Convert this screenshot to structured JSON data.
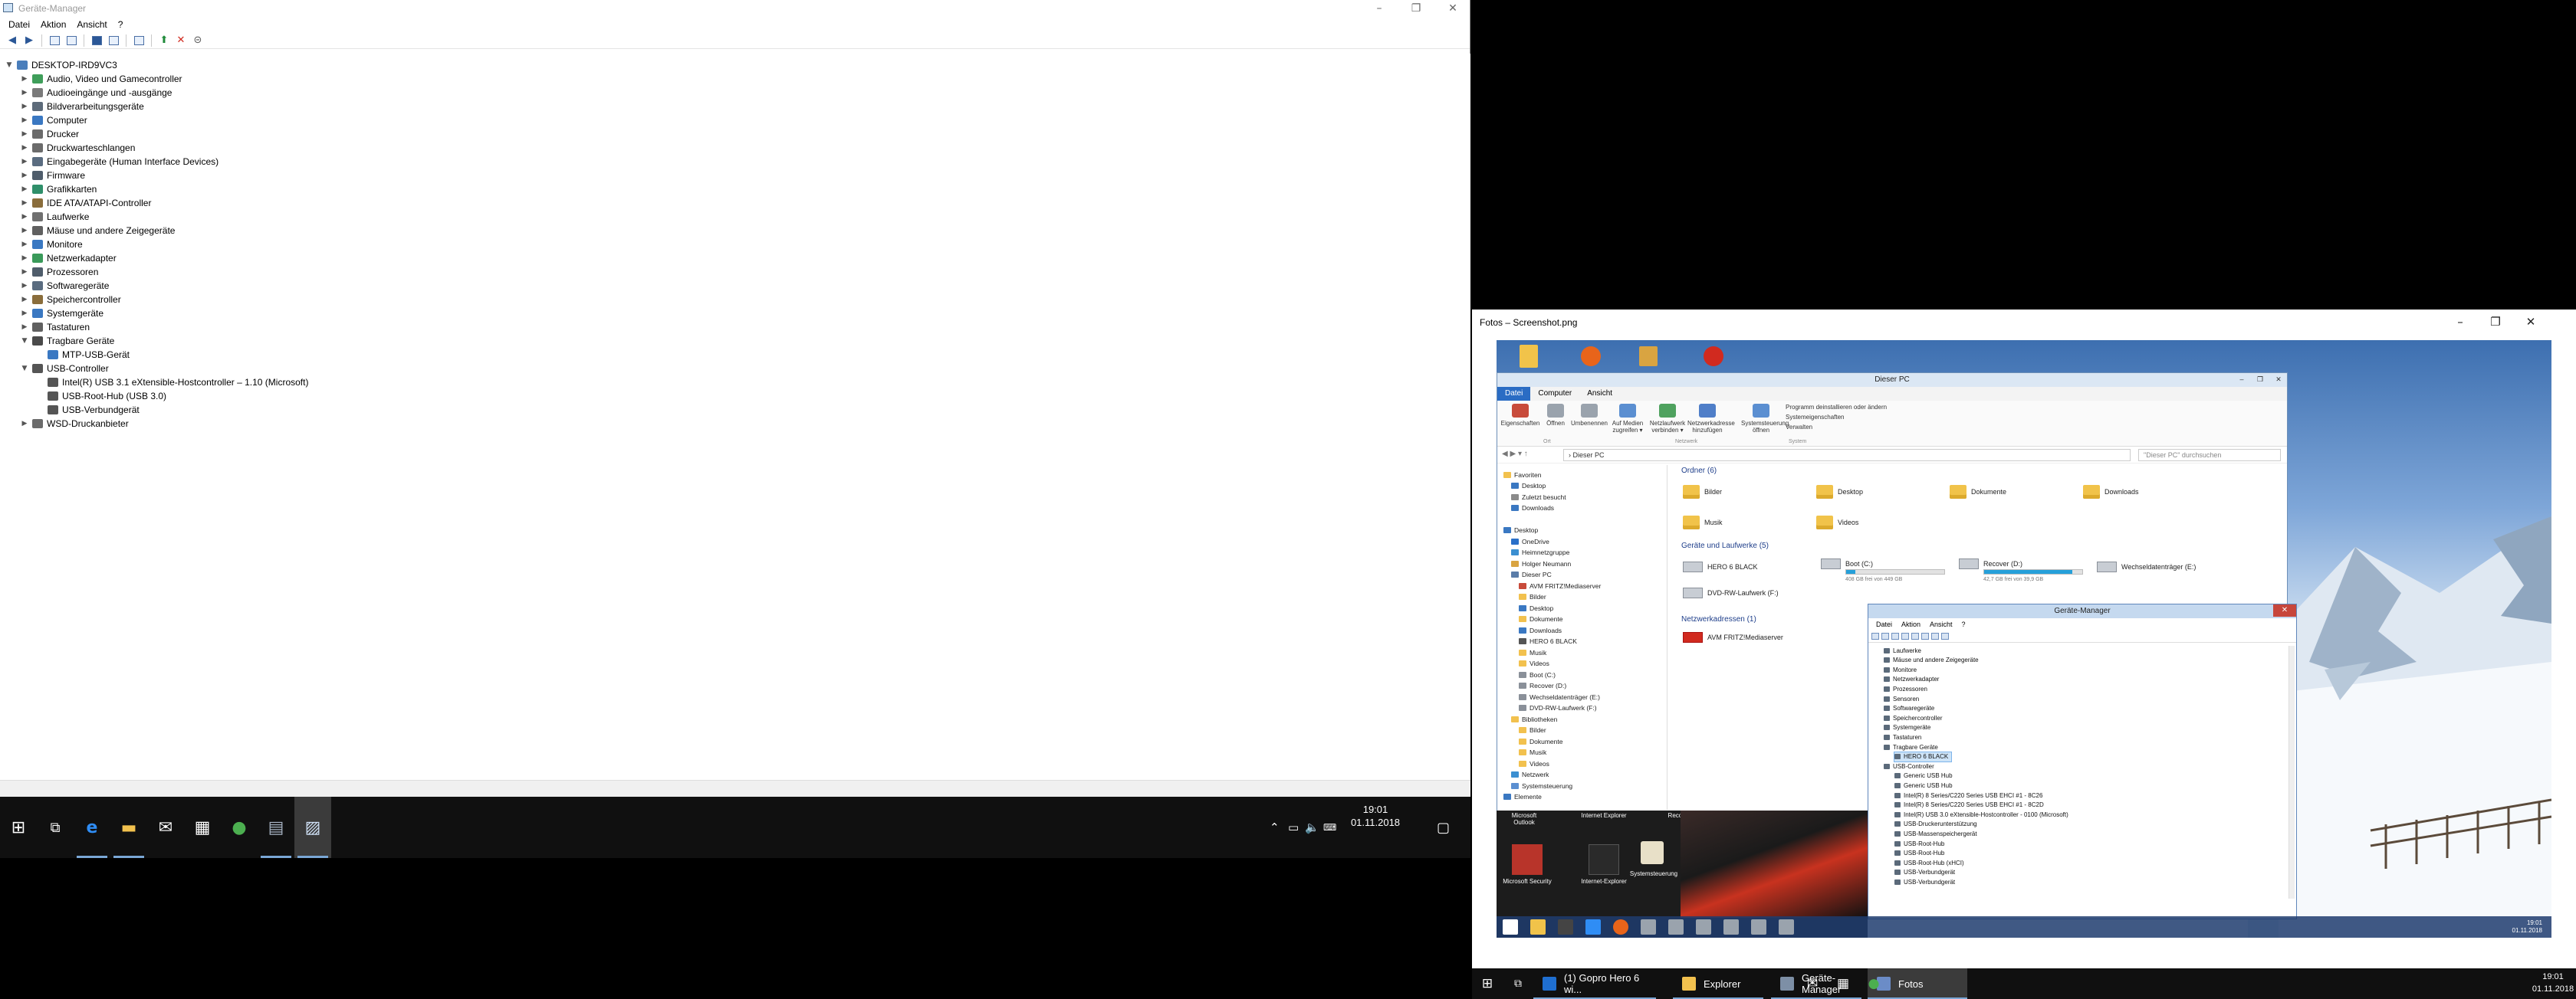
{
  "dm": {
    "title": "Geräte-Manager",
    "menu": [
      "Datei",
      "Aktion",
      "Ansicht",
      "?"
    ],
    "tree": [
      {
        "label": "DESKTOP-IRD9VC3",
        "indent": 0,
        "exp": "open",
        "icon": "#4a7ebb"
      },
      {
        "label": "Audio, Video und Gamecontroller",
        "indent": 1,
        "exp": "closed",
        "icon": "#3f9e5a"
      },
      {
        "label": "Audioeingänge und -ausgänge",
        "indent": 1,
        "exp": "closed",
        "icon": "#7a7a7a"
      },
      {
        "label": "Bildverarbeitungsgeräte",
        "indent": 1,
        "exp": "closed",
        "icon": "#5d6b7a"
      },
      {
        "label": "Computer",
        "indent": 1,
        "exp": "closed",
        "icon": "#3a78c2"
      },
      {
        "label": "Drucker",
        "indent": 1,
        "exp": "closed",
        "icon": "#6b6b6b"
      },
      {
        "label": "Druckwarteschlangen",
        "indent": 1,
        "exp": "closed",
        "icon": "#6b6b6b"
      },
      {
        "label": "Eingabegeräte (Human Interface Devices)",
        "indent": 1,
        "exp": "closed",
        "icon": "#5a6c80"
      },
      {
        "label": "Firmware",
        "indent": 1,
        "exp": "closed",
        "icon": "#4f5d6b"
      },
      {
        "label": "Grafikkarten",
        "indent": 1,
        "exp": "closed",
        "icon": "#2f8f6a"
      },
      {
        "label": "IDE ATA/ATAPI-Controller",
        "indent": 1,
        "exp": "closed",
        "icon": "#8a6d3b"
      },
      {
        "label": "Laufwerke",
        "indent": 1,
        "exp": "closed",
        "icon": "#707070"
      },
      {
        "label": "Mäuse und andere Zeigegeräte",
        "indent": 1,
        "exp": "closed",
        "icon": "#606060"
      },
      {
        "label": "Monitore",
        "indent": 1,
        "exp": "closed",
        "icon": "#3a78c2"
      },
      {
        "label": "Netzwerkadapter",
        "indent": 1,
        "exp": "closed",
        "icon": "#3a9a5a"
      },
      {
        "label": "Prozessoren",
        "indent": 1,
        "exp": "closed",
        "icon": "#4f5d6b"
      },
      {
        "label": "Softwaregeräte",
        "indent": 1,
        "exp": "closed",
        "icon": "#5a6c80"
      },
      {
        "label": "Speichercontroller",
        "indent": 1,
        "exp": "closed",
        "icon": "#8a6d3b"
      },
      {
        "label": "Systemgeräte",
        "indent": 1,
        "exp": "closed",
        "icon": "#3a78c2"
      },
      {
        "label": "Tastaturen",
        "indent": 1,
        "exp": "closed",
        "icon": "#606060"
      },
      {
        "label": "Tragbare Geräte",
        "indent": 1,
        "exp": "open",
        "icon": "#4a4a4a"
      },
      {
        "label": "MTP-USB-Gerät",
        "indent": 2,
        "exp": "none",
        "icon": "#3a78c2"
      },
      {
        "label": "USB-Controller",
        "indent": 1,
        "exp": "open",
        "icon": "#555555"
      },
      {
        "label": "Intel(R) USB 3.1 eXtensible-Hostcontroller – 1.10 (Microsoft)",
        "indent": 2,
        "exp": "none",
        "icon": "#555555"
      },
      {
        "label": "USB-Root-Hub (USB 3.0)",
        "indent": 2,
        "exp": "none",
        "icon": "#555555"
      },
      {
        "label": "USB-Verbundgerät",
        "indent": 2,
        "exp": "none",
        "icon": "#555555"
      },
      {
        "label": "WSD-Druckanbieter",
        "indent": 1,
        "exp": "closed",
        "icon": "#6b6b6b"
      }
    ]
  },
  "taskbar_left": {
    "time": "19:01",
    "date": "01.11.2018"
  },
  "fotos": {
    "title": "Fotos – Screenshot.png"
  },
  "photo": {
    "explorer": {
      "title": "Dieser PC",
      "tabs": [
        "Datei",
        "Computer",
        "Ansicht"
      ],
      "ribbon": [
        {
          "label": "Eigenschaften",
          "color": "#c84b3b"
        },
        {
          "label": "Öffnen",
          "color": "#9aa3ad"
        },
        {
          "label": "Umbenennen",
          "color": "#9aa3ad"
        },
        {
          "label": "Auf Medien zugreifen ▾",
          "color": "#5b8fd1"
        },
        {
          "label": "Netzlaufwerk verbinden ▾",
          "color": "#4fa25f"
        },
        {
          "label": "Netzwerkadresse hinzufügen",
          "color": "#4f7ec8"
        },
        {
          "label": "Systemsteuerung öffnen",
          "color": "#5b8fd1"
        }
      ],
      "ribbon_side": [
        "Programm deinstallieren oder ändern",
        "Systemeigenschaften",
        "Verwalten"
      ],
      "ribbon_groups": [
        "Ort",
        "Netzwerk",
        "System"
      ],
      "address": "› Dieser PC",
      "search": "\"Dieser PC\" durchsuchen",
      "nav": [
        {
          "label": "Favoriten",
          "indent": 0,
          "color": "#f2c14e"
        },
        {
          "label": "Desktop",
          "indent": 1,
          "color": "#3a78c2"
        },
        {
          "label": "Zuletzt besucht",
          "indent": 1,
          "color": "#8b8b8b"
        },
        {
          "label": "Downloads",
          "indent": 1,
          "color": "#3a78c2"
        },
        {
          "label": "",
          "indent": 0,
          "color": "transparent"
        },
        {
          "label": "Desktop",
          "indent": 0,
          "color": "#3a78c2"
        },
        {
          "label": "OneDrive",
          "indent": 1,
          "color": "#2a70c9"
        },
        {
          "label": "Heimnetzgruppe",
          "indent": 1,
          "color": "#3b8fd1"
        },
        {
          "label": "Holger Neumann",
          "indent": 1,
          "color": "#d9a441"
        },
        {
          "label": "Dieser PC",
          "indent": 1,
          "color": "#5a7ca8"
        },
        {
          "label": "AVM FRITZ!Mediaserver",
          "indent": 2,
          "color": "#c84b3b"
        },
        {
          "label": "Bilder",
          "indent": 2,
          "color": "#f2c14e"
        },
        {
          "label": "Desktop",
          "indent": 2,
          "color": "#3a78c2"
        },
        {
          "label": "Dokumente",
          "indent": 2,
          "color": "#f2c14e"
        },
        {
          "label": "Downloads",
          "indent": 2,
          "color": "#3a78c2"
        },
        {
          "label": "HERO 6 BLACK",
          "indent": 2,
          "color": "#555555"
        },
        {
          "label": "Musik",
          "indent": 2,
          "color": "#f2c14e"
        },
        {
          "label": "Videos",
          "indent": 2,
          "color": "#f2c14e"
        },
        {
          "label": "Boot (C:)",
          "indent": 2,
          "color": "#8a9099"
        },
        {
          "label": "Recover (D:)",
          "indent": 2,
          "color": "#8a9099"
        },
        {
          "label": "Wechseldatenträger (E:)",
          "indent": 2,
          "color": "#8a9099"
        },
        {
          "label": "DVD-RW-Laufwerk (F:)",
          "indent": 2,
          "color": "#8a9099"
        },
        {
          "label": "Bibliotheken",
          "indent": 1,
          "color": "#f2c14e"
        },
        {
          "label": "Bilder",
          "indent": 2,
          "color": "#f2c14e"
        },
        {
          "label": "Dokumente",
          "indent": 2,
          "color": "#f2c14e"
        },
        {
          "label": "Musik",
          "indent": 2,
          "color": "#f2c14e"
        },
        {
          "label": "Videos",
          "indent": 2,
          "color": "#f2c14e"
        },
        {
          "label": "Netzwerk",
          "indent": 1,
          "color": "#3b8fd1"
        },
        {
          "label": "Systemsteuerung",
          "indent": 1,
          "color": "#5b8fd1"
        },
        {
          "label": "Elemente",
          "indent": 0,
          "color": "#3a78c2"
        }
      ],
      "folders_head": "Ordner (6)",
      "folders": [
        "Bilder",
        "Desktop",
        "Dokumente",
        "Downloads",
        "Musik",
        "Videos"
      ],
      "devices_head": "Geräte und Laufwerke (5)",
      "devices": [
        {
          "name": "HERO 6 BLACK",
          "free": "",
          "fill": 0
        },
        {
          "name": "Boot (C:)",
          "free": "408 GB frei von 449 GB",
          "fill": 0.09
        },
        {
          "name": "Recover (D:)",
          "free": "42,7 GB frei von 39,9 GB",
          "fill": 0.9
        },
        {
          "name": "Wechseldatenträger (E:)",
          "free": "",
          "fill": 0
        },
        {
          "name": "DVD-RW-Laufwerk (F:)",
          "free": "",
          "fill": 0
        }
      ],
      "network_head": "Netzwerkadressen (1)",
      "network": [
        "AVM FRITZ!Mediaserver"
      ]
    },
    "dm2": {
      "title": "Geräte-Manager",
      "menu": [
        "Datei",
        "Aktion",
        "Ansicht",
        "?"
      ],
      "rows": [
        {
          "label": "Laufwerke",
          "indent": 0
        },
        {
          "label": "Mäuse und andere Zeigegeräte",
          "indent": 0
        },
        {
          "label": "Monitore",
          "indent": 0
        },
        {
          "label": "Netzwerkadapter",
          "indent": 0
        },
        {
          "label": "Prozessoren",
          "indent": 0
        },
        {
          "label": "Sensoren",
          "indent": 0
        },
        {
          "label": "Softwaregeräte",
          "indent": 0
        },
        {
          "label": "Speichercontroller",
          "indent": 0
        },
        {
          "label": "Systemgeräte",
          "indent": 0
        },
        {
          "label": "Tastaturen",
          "indent": 0
        },
        {
          "label": "Tragbare Geräte",
          "indent": 0
        },
        {
          "label": "HERO 6 BLACK",
          "indent": 1,
          "sel": true
        },
        {
          "label": "USB-Controller",
          "indent": 0
        },
        {
          "label": "Generic USB Hub",
          "indent": 1
        },
        {
          "label": "Generic USB Hub",
          "indent": 1
        },
        {
          "label": "Intel(R) 8 Series/C220 Series USB EHCI #1 - 8C26",
          "indent": 1
        },
        {
          "label": "Intel(R) 8 Series/C220 Series USB EHCI #1 - 8C2D",
          "indent": 1
        },
        {
          "label": "Intel(R) USB 3.0 eXtensible-Hostcontroller - 0100 (Microsoft)",
          "indent": 1
        },
        {
          "label": "USB-Druckerunterstützung",
          "indent": 1
        },
        {
          "label": "USB-Massenspeichergerät",
          "indent": 1
        },
        {
          "label": "USB-Root-Hub",
          "indent": 1
        },
        {
          "label": "USB-Root-Hub",
          "indent": 1
        },
        {
          "label": "USB-Root-Hub (xHCI)",
          "indent": 1
        },
        {
          "label": "USB-Verbundgerät",
          "indent": 1
        },
        {
          "label": "USB-Verbundgerät",
          "indent": 1
        }
      ]
    },
    "bottom_tiles": [
      "Microsoft Outlook",
      "Internet Explorer",
      "Recorder"
    ],
    "bottom_labels": [
      "Microsoft Security",
      "Internet-Explorer"
    ],
    "bottom_caption": "Systemsteuerung",
    "taskbar_time": "19:01",
    "taskbar_date": "01.11.2018"
  },
  "taskbar_right": {
    "apps": [
      {
        "label": "(1) Gopro Hero 6 wi...",
        "color": "#1f6fd1",
        "active": false
      },
      {
        "label": "Explorer",
        "color": "#f2c14e",
        "active": false
      },
      {
        "label": "Geräte-Manager",
        "color": "#7d8fa6",
        "active": false
      },
      {
        "label": "Fotos",
        "color": "#6b8cc7",
        "active": true
      }
    ],
    "time": "19:01",
    "date": "01.11.2018"
  }
}
